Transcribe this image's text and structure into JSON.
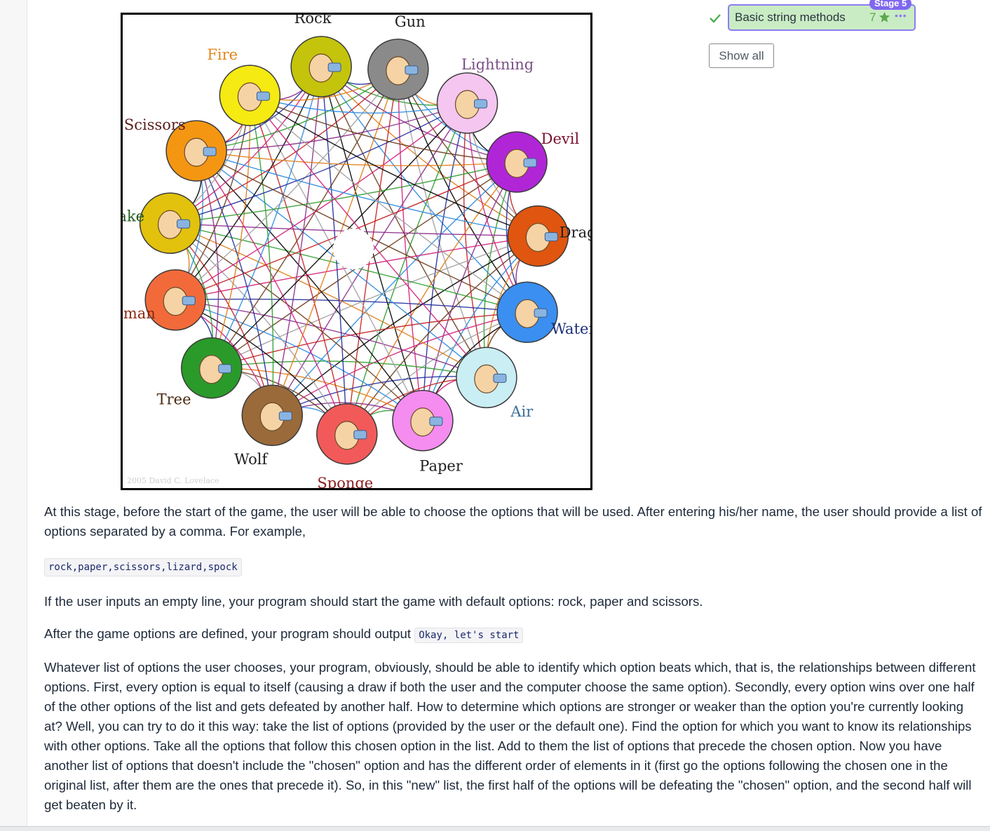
{
  "figure": {
    "copyright": "2005 David C. Lovelace",
    "gestures": [
      {
        "name": "Rock",
        "fill": "#c4c40c",
        "text_color": "#1e1e1e"
      },
      {
        "name": "Gun",
        "fill": "#8a8a8a",
        "text_color": "#1e1e1e"
      },
      {
        "name": "Lightning",
        "fill": "#f4c6f0",
        "text_color": "#7a4f86"
      },
      {
        "name": "Devil",
        "fill": "#b026d6",
        "text_color": "#7a1030"
      },
      {
        "name": "Dragon",
        "fill": "#e0550f",
        "text_color": "#1e1e1e"
      },
      {
        "name": "Water",
        "fill": "#3a8ff0",
        "text_color": "#1b2f7a"
      },
      {
        "name": "Air",
        "fill": "#c9eef4",
        "text_color": "#3a6f9a"
      },
      {
        "name": "Paper",
        "fill": "#f58cf0",
        "text_color": "#1e1e1e"
      },
      {
        "name": "Sponge",
        "fill": "#f25a5a",
        "text_color": "#8a1e1e"
      },
      {
        "name": "Wolf",
        "fill": "#9a6a3a",
        "text_color": "#1e1e1e"
      },
      {
        "name": "Tree",
        "fill": "#2a9a2a",
        "text_color": "#4a2a10"
      },
      {
        "name": "Human",
        "fill": "#f26a3a",
        "text_color": "#8a2a10"
      },
      {
        "name": "Snake",
        "fill": "#e2c20c",
        "text_color": "#1e5a1e"
      },
      {
        "name": "Scissors",
        "fill": "#f59612",
        "text_color": "#5a1e1e"
      },
      {
        "name": "Fire",
        "fill": "#f5ea12",
        "text_color": "#e0861a"
      }
    ],
    "arrow_colors": [
      "#c21e1e",
      "#1e2a9a",
      "#2a9a2a",
      "#8a2a8a",
      "#e07a12",
      "#2a8ae0",
      "#6a3a1a",
      "#000000",
      "#a0a0a0",
      "#d01e7a"
    ]
  },
  "stage": {
    "badge": "Stage 5",
    "title": "Basic string methods",
    "score": "7",
    "accent": "#7f67f0",
    "card_bg": "#c9ecc4"
  },
  "show_all": "Show all",
  "text": {
    "p1": "At this stage, before the start of the game, the user will be able to choose the options that will be used. After entering his/her name, the user should provide a list of options separated by a comma. For example,",
    "code_example": "rock,paper,scissors,lizard,spock",
    "p2": "If the user inputs an empty line, your program should start the game with default options: rock, paper and scissors.",
    "p3_before": "After the game options are defined, your program should output ",
    "p3_code": "Okay, let's start",
    "p4": "Whatever list of options the user chooses, your program, obviously, should be able to identify which option beats which, that is, the relationships between different options. First, every option is equal to itself (causing a draw if both the user and the computer choose the same option). Secondly, every option wins over one half of the other options of the list and gets defeated by another half. How to determine which options are stronger or weaker than the option you're currently looking at? Well, you can try to do it this way: take the list of options (provided by the user or the default one). Find the option for which you want to know its relationships with other options. Take all the options that follow this chosen option in the list. Add to them the list of options that precede the chosen option. Now you have another list of options that doesn't include the \"chosen\" option and has the different order of elements in it (first go the options following the chosen one in the original list, after them are the ones that precede it). So, in this \"new\" list, the first half of the options will be defeating the \"chosen\" option, and the second half will get beaten by it."
  }
}
